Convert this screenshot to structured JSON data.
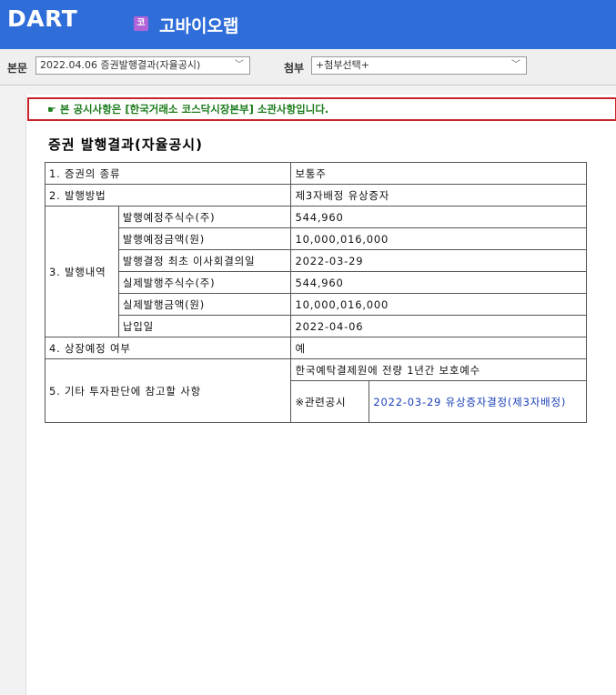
{
  "header": {
    "logo": "DART",
    "company_badge": "코",
    "company_name": "고바이오랩"
  },
  "toolbar": {
    "main_label": "본문",
    "main_select": "2022.04.06  증권발행결과(자율공시)",
    "attach_label": "첨부",
    "attach_select": "+첨부선택+"
  },
  "notice": {
    "icon": "pointing-hand-icon",
    "text": "본 공시사항은 [한국거래소 코스닥시장본부] 소관사항입니다."
  },
  "doc": {
    "title": "증권 발행결과(자율공시)",
    "rows": {
      "r1_label": "1. 증권의 종류",
      "r1_value": "보통주",
      "r2_label": "2. 발행방법",
      "r2_value": "제3자배정 유상증자",
      "r3_label": "3. 발행내역",
      "r3_items": [
        {
          "label": "발행예정주식수(주)",
          "value": "544,960"
        },
        {
          "label": "발행예정금액(원)",
          "value": "10,000,016,000"
        },
        {
          "label": "발행결정 최초 이사회결의일",
          "value": "2022-03-29"
        },
        {
          "label": "실제발행주식수(주)",
          "value": "544,960"
        },
        {
          "label": "실제발행금액(원)",
          "value": "10,000,016,000"
        },
        {
          "label": "납입일",
          "value": "2022-04-06"
        }
      ],
      "r4_label": "4. 상장예정 여부",
      "r4_value": "예",
      "r5_label": "5. 기타 투자판단에 참고할 사항",
      "r5_value": "한국예탁결제원에 전량 1년간 보호예수",
      "r5_related_label": "※관련공시",
      "r5_related_link": "2022-03-29 유상증자결정(제3자배정)"
    }
  },
  "colors": {
    "header_bg": "#2f6ed9",
    "notice_border": "#c8232c",
    "notice_text": "#1b7c1b",
    "link": "#1a3fb8"
  }
}
